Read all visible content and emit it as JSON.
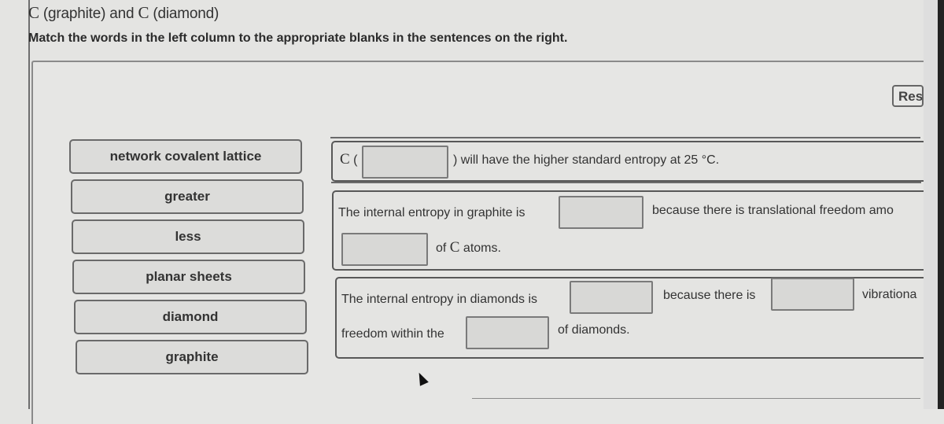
{
  "header": {
    "title_c1": "C",
    "title_mid": " (graphite) and ",
    "title_c2": "C",
    "title_end": " (diamond)",
    "instructions": "Match the words in the left column to the appropriate blanks in the sentences on the right."
  },
  "reset_label": "Reset",
  "words": [
    {
      "label": "network covalent lattice"
    },
    {
      "label": "greater"
    },
    {
      "label": "less"
    },
    {
      "label": "planar sheets"
    },
    {
      "label": "diamond"
    },
    {
      "label": "graphite"
    }
  ],
  "sentences": [
    {
      "c_symbol": "C",
      "prefix": " (",
      "text_after": ") will have the higher standard entropy at 25 °C."
    },
    {
      "text_before": "The internal entropy in graphite is",
      "text_mid": "because there is translational freedom amo",
      "text_end_pre": "of ",
      "c_symbol": "C",
      "text_end_post": " atoms."
    },
    {
      "text_before": "The internal entropy in diamonds is",
      "text_mid": "because there is",
      "text_cut": "vibrationa",
      "line2_before": "freedom within the",
      "line2_after": "of diamonds."
    }
  ],
  "blanks": [
    {
      "id": "s1-blank1",
      "value": ""
    },
    {
      "id": "s2-blank1",
      "value": ""
    },
    {
      "id": "s2-blank2",
      "value": ""
    },
    {
      "id": "s3-blank1",
      "value": ""
    },
    {
      "id": "s3-blank2",
      "value": ""
    },
    {
      "id": "s3-blank3",
      "value": ""
    }
  ]
}
